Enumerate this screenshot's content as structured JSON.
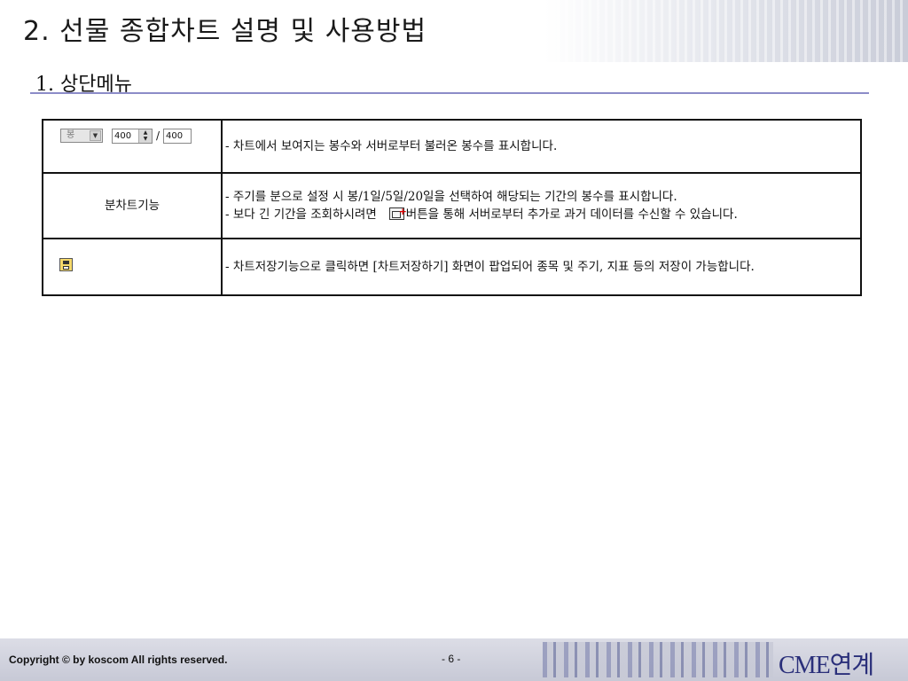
{
  "header": {
    "page_title": "2. 선물 종합차트 설명 및 사용방법",
    "section_title": "1. 상단메뉴"
  },
  "table": {
    "row1": {
      "widget": {
        "select_value": "봉",
        "count_value": "400",
        "separator": "/",
        "total_value": "400"
      },
      "description": "- 차트에서 보여지는 봉수와 서버로부터 불러온 봉수를 표시합니다."
    },
    "row2": {
      "label": "분차트기능",
      "line1": "- 주기를 분으로 설정 시 봉/1일/5일/20일을 선택하여 해당되는 기간의 봉수를 표시합니다.",
      "line2_before": "- 보다 긴 기간을 조회하시려면",
      "line2_after": "버튼을 통해 서버로부터 추가로 과거 데이터를 수신할 수 있습니다."
    },
    "row3": {
      "icon": "save-icon",
      "description": "- 차트저장기능으로 클릭하면 [차트저장하기] 화면이 팝업되어 종목 및 주기, 지표 등의 저장이 가능합니다."
    }
  },
  "footer": {
    "copyright": "Copyright © by koscom All rights reserved.",
    "page_number": "- 6 -",
    "brand": "CME연계"
  }
}
